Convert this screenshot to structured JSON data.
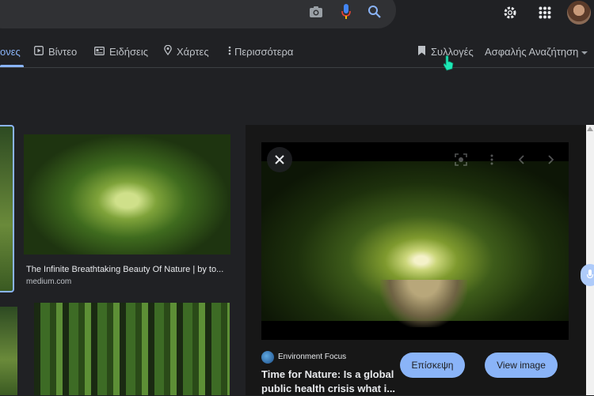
{
  "header": {
    "camera_icon": "camera-icon",
    "mic_icon": "mic-icon",
    "search_icon": "search-icon",
    "settings_icon": "gear-icon",
    "apps_icon": "apps-grid-icon",
    "avatar": "avatar"
  },
  "tabs": [
    {
      "label": "ονες",
      "active": true
    },
    {
      "label": "Βίντεο",
      "icon": "play-icon"
    },
    {
      "label": "Ειδήσεις",
      "icon": "news-icon"
    },
    {
      "label": "Χάρτες",
      "icon": "location-icon"
    },
    {
      "label": "Περισσότερα",
      "icon": "more-vert-icon"
    }
  ],
  "tabs_right": {
    "collections": "Συλλογές",
    "safesearch": "Ασφαλής Αναζήτηση"
  },
  "results": [
    {
      "title": "The Infinite Breathtaking Beauty Of Nature | by to...",
      "source": "medium.com"
    }
  ],
  "preview": {
    "source_name": "Environment Focus",
    "headline": "Time for Nature: Is a global public health crisis what i...",
    "visit_label": "Επίσκεψη",
    "view_image_label": "View image"
  },
  "colors": {
    "background": "#202124",
    "accent": "#8ab4f8",
    "panel": "#171717"
  }
}
